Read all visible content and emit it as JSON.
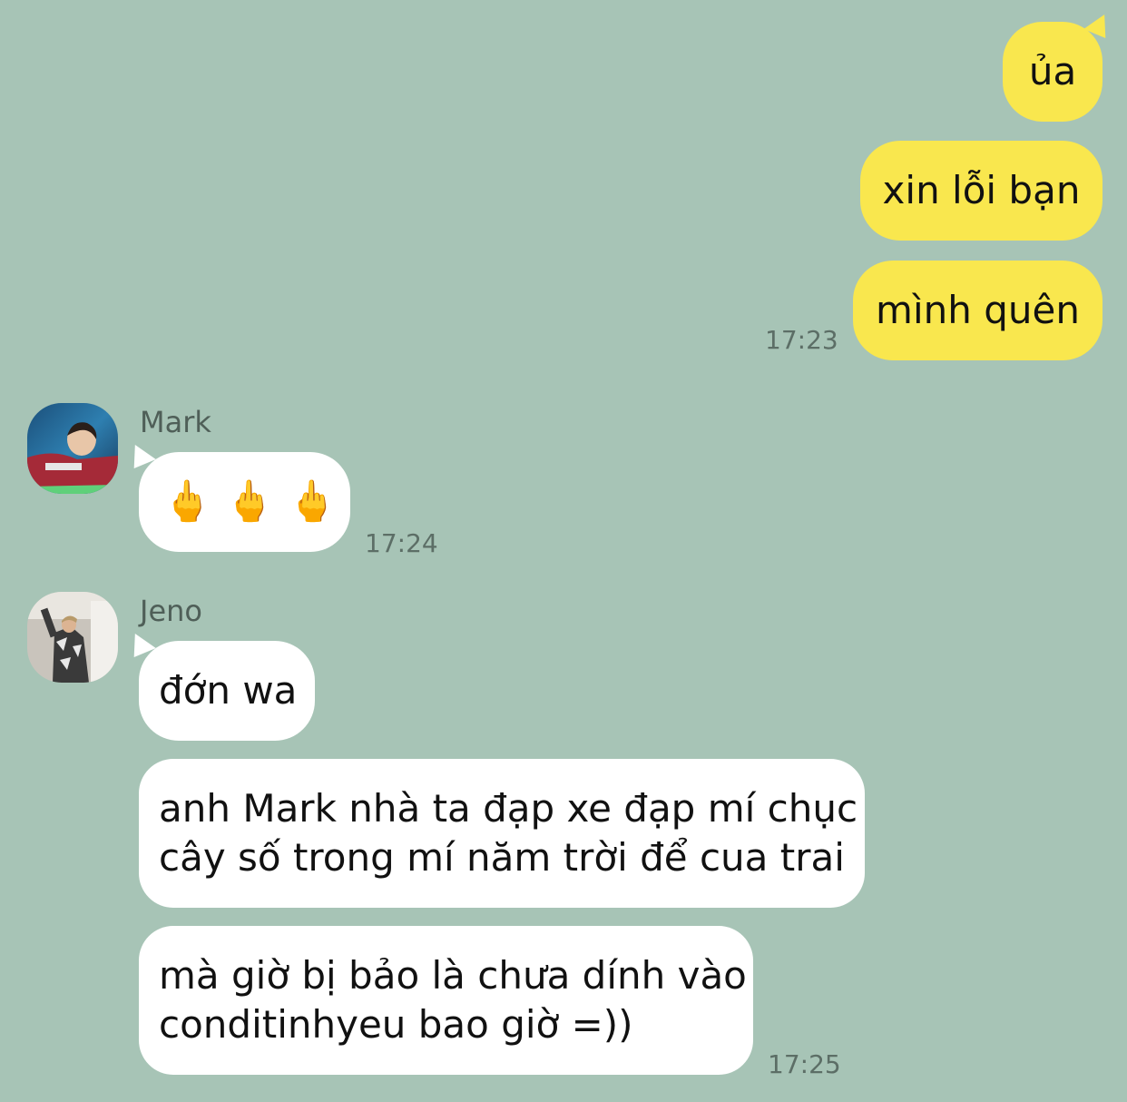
{
  "outgoing": [
    {
      "text": "ủa"
    },
    {
      "text": "xin lỗi bạn"
    },
    {
      "text": "mình quên"
    }
  ],
  "outgoing_time": "17:23",
  "mark": {
    "name": "Mark",
    "message": "🖕🖕🖕",
    "time": "17:24"
  },
  "jeno": {
    "name": "Jeno",
    "message1": "đớn wa",
    "message2_line1": "anh Mark nhà ta đạp xe đạp mí chục",
    "message2_line2": "cây số trong mí năm trời để cua trai",
    "message3_line1": "mà giờ bị bảo là chưa dính vào",
    "message3_line2": "conditinhyeu bao giờ =))",
    "time": "17:25"
  },
  "colors": {
    "background": "#a7c4b6",
    "outgoing_bubble": "#f9e74e",
    "incoming_bubble": "#ffffff"
  }
}
